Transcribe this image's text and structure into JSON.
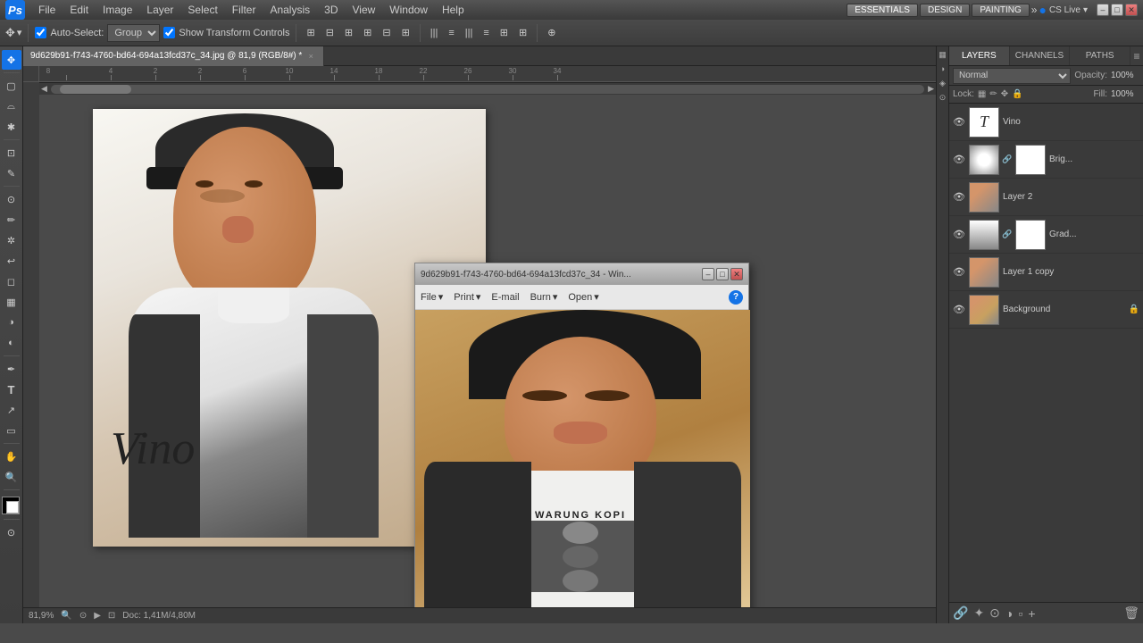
{
  "app": {
    "logo": "Ps",
    "workspace_buttons": [
      "ESSENTIALS",
      "DESIGN",
      "PAINTING"
    ],
    "cs_live": "CS Live"
  },
  "menu": {
    "items": [
      "File",
      "Edit",
      "Image",
      "Layer",
      "Select",
      "Filter",
      "Analysis",
      "3D",
      "View",
      "Window",
      "Help"
    ]
  },
  "toolbar_top": {
    "auto_select_label": "Auto-Select:",
    "group_value": "Group",
    "show_transform": "Show Transform Controls"
  },
  "tab": {
    "title": "9d629b91-f743-4760-bd64-694a13fcd37c_34.jpg @ 81,9 (RGB/8#) *",
    "close": "×"
  },
  "photo_window": {
    "title": "9d629b91-f743-4760-bd64-694a13fcd37c_34 - Win...",
    "menu_items": [
      "File",
      "Print",
      "E-mail",
      "Burn",
      "Open"
    ]
  },
  "canvas": {
    "zoom": "81,9%",
    "vino_text": "Vino"
  },
  "layers_panel": {
    "tabs": [
      "LAYERS",
      "CHANNELS",
      "PATHS"
    ],
    "blend_mode": "Normal",
    "opacity_label": "Opacity:",
    "opacity_value": "100%",
    "lock_label": "Lock:",
    "fill_label": "Fill:",
    "fill_value": "100%",
    "layers": [
      {
        "name": "Vino",
        "type": "text",
        "visible": true
      },
      {
        "name": "Brig...",
        "type": "adjustment",
        "visible": true,
        "has_mask": true
      },
      {
        "name": "Layer 2",
        "type": "photo",
        "visible": true,
        "has_mask": false
      },
      {
        "name": "Grad...",
        "type": "gradient",
        "visible": true,
        "has_mask": true
      },
      {
        "name": "Layer 1 copy",
        "type": "photo",
        "visible": true
      },
      {
        "name": "Background",
        "type": "photo",
        "visible": true,
        "locked": true
      }
    ]
  },
  "status_bar": {
    "zoom": "81,9%",
    "doc_info": "Doc: 1,41M/4,80M"
  },
  "ruler": {
    "h_ticks": [
      "8",
      "4",
      "2",
      "2",
      "6",
      "10",
      "14",
      "18",
      "22",
      "26",
      "30",
      "34"
    ],
    "units": "cm"
  }
}
